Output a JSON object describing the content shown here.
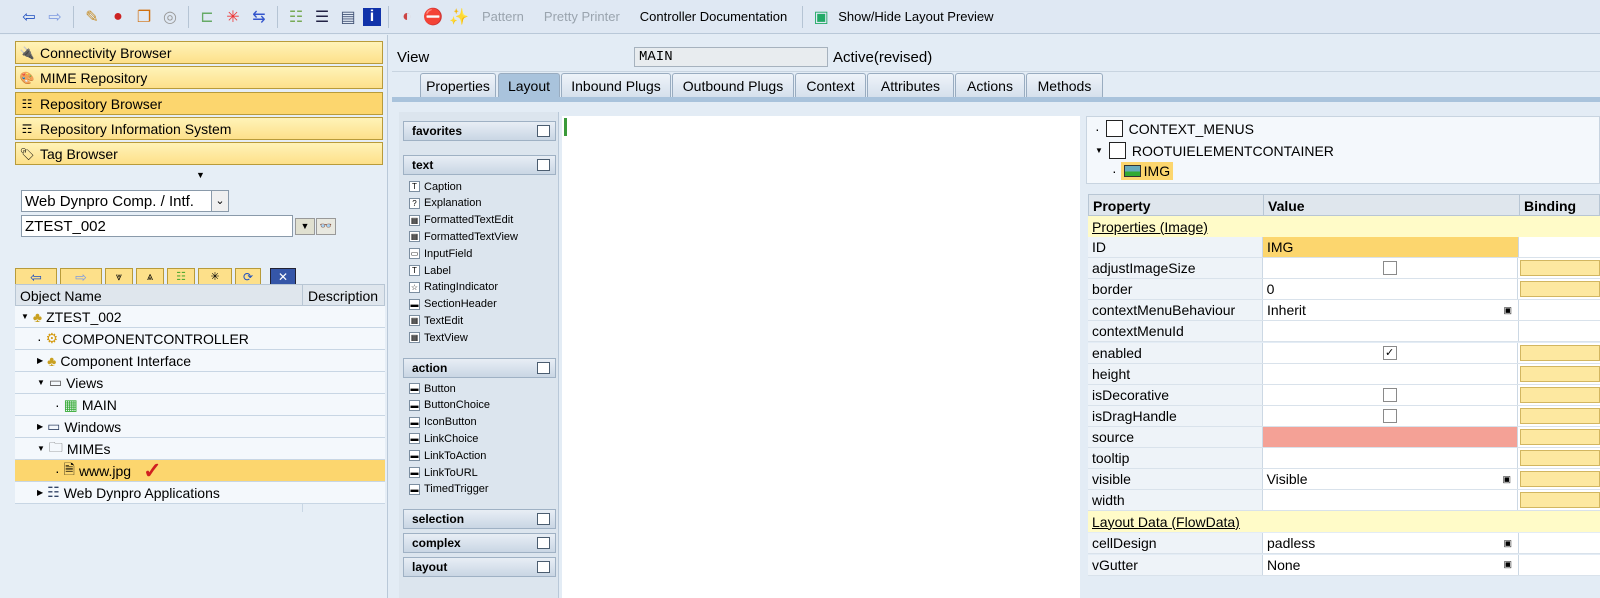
{
  "toolbar": {
    "pattern": "Pattern",
    "pretty_printer": "Pretty Printer",
    "controller_doc": "Controller Documentation",
    "layout_preview": "Show/Hide Layout Preview"
  },
  "left": {
    "buttons": [
      "Connectivity Browser",
      "MIME Repository",
      "Repository Browser",
      "Repository Information System",
      "Tag Browser"
    ],
    "object_type": "Web Dynpro Comp. / Intf.",
    "object_name": "ZTEST_002",
    "columns": {
      "name": "Object Name",
      "description": "Description"
    },
    "tree": [
      {
        "label": "ZTEST_002",
        "icon": "component-icon"
      },
      {
        "label": "COMPONENTCONTROLLER",
        "icon": "controller-icon"
      },
      {
        "label": "Component Interface",
        "icon": "interface-icon"
      },
      {
        "label": "Views",
        "icon": "views-folder-icon"
      },
      {
        "label": "MAIN",
        "icon": "view-icon"
      },
      {
        "label": "Windows",
        "icon": "windows-folder-icon"
      },
      {
        "label": "MIMEs",
        "icon": "folder-icon"
      },
      {
        "label": "www.jpg",
        "icon": "file-icon"
      },
      {
        "label": "Web Dynpro Applications",
        "icon": "applications-icon"
      }
    ]
  },
  "view": {
    "label": "View",
    "name": "MAIN",
    "status": "Active(revised)"
  },
  "tabs": [
    "Properties",
    "Layout",
    "Inbound Plugs",
    "Outbound Plugs",
    "Context",
    "Attributes",
    "Actions",
    "Methods"
  ],
  "palette": {
    "favorites": "favorites",
    "text": "text",
    "text_items": [
      "Caption",
      "Explanation",
      "FormattedTextEdit",
      "FormattedTextView",
      "InputField",
      "Label",
      "RatingIndicator",
      "SectionHeader",
      "TextEdit",
      "TextView"
    ],
    "action": "action",
    "action_items": [
      "Button",
      "ButtonChoice",
      "IconButton",
      "LinkChoice",
      "LinkToAction",
      "LinkToURL",
      "TimedTrigger"
    ],
    "selection": "selection",
    "complex": "complex",
    "layout": "layout"
  },
  "hierarchy": [
    "CONTEXT_MENUS",
    "ROOTUIELEMENTCONTAINER",
    "IMG"
  ],
  "props": {
    "headers": [
      "Property",
      "Value",
      "Binding"
    ],
    "section1": "Properties (Image)",
    "rows": [
      {
        "p": "ID",
        "v": "IMG"
      },
      {
        "p": "adjustImageSize",
        "v": ""
      },
      {
        "p": "border",
        "v": "0"
      },
      {
        "p": "contextMenuBehaviour",
        "v": "Inherit"
      },
      {
        "p": "contextMenuId",
        "v": ""
      },
      {
        "p": "enabled",
        "v": ""
      },
      {
        "p": "height",
        "v": ""
      },
      {
        "p": "isDecorative",
        "v": ""
      },
      {
        "p": "isDragHandle",
        "v": ""
      },
      {
        "p": "source",
        "v": ""
      },
      {
        "p": "tooltip",
        "v": ""
      },
      {
        "p": "visible",
        "v": "Visible"
      },
      {
        "p": "width",
        "v": ""
      }
    ],
    "section2": "Layout Data (FlowData)",
    "rows2": [
      {
        "p": "cellDesign",
        "v": "padless"
      },
      {
        "p": "vGutter",
        "v": "None"
      }
    ],
    "checkmark": "✓"
  }
}
